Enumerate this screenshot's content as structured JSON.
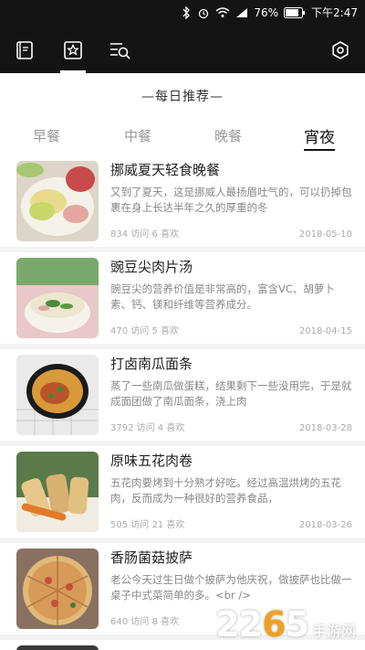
{
  "status_bar": {
    "battery": "76%",
    "time": "下午2:47"
  },
  "navbar": {
    "icons": [
      "book-icon",
      "star-card-icon",
      "search-list-icon",
      "settings-icon"
    ]
  },
  "daily": {
    "title": "—每日推荐—"
  },
  "tabs": [
    {
      "label": "早餐"
    },
    {
      "label": "中餐"
    },
    {
      "label": "晚餐"
    },
    {
      "label": "宵夜",
      "active": true
    }
  ],
  "items": [
    {
      "title": "挪威夏天轻食晚餐",
      "desc": "又到了夏天，这是挪威人最扬眉吐气的，可以扔掉包裹在身上长达半年之久的厚重的冬",
      "meta": "834 访问 6 喜欢",
      "date": "2018-05-10"
    },
    {
      "title": "豌豆尖肉片汤",
      "desc": "豌豆尖的营养价值是非常高的，富含VC、胡萝卜素、钙、镁和纤维等营养成分。",
      "meta": "470 访问 5 喜欢",
      "date": "2018-04-15"
    },
    {
      "title": "打卤南瓜面条",
      "desc": "蒸了一些南瓜做蛋糕，结果剩下一些没用完，于是就成面团做了南瓜面条，浇上肉",
      "meta": "3792 访问 4 喜欢",
      "date": "2018-03-28"
    },
    {
      "title": "原味五花肉卷",
      "desc": "五花肉要烤到十分熟才好吃。经过高温烘烤的五花肉，反而成为一种很好的营养食品，",
      "meta": "505 访问 21 喜欢",
      "date": "2018-03-26"
    },
    {
      "title": "香肠菌菇披萨",
      "desc": "老公今天过生日做个披萨为他庆祝，做披萨也比做一桌子中式菜简单的多。<br />",
      "meta": "640 访问 8 喜欢",
      "date": ""
    }
  ],
  "watermark": {
    "number_pre": "22",
    "number_hl": "6",
    "number_post": "5",
    "text": "手游网"
  },
  "colors": {
    "bar": "#141414",
    "background": "#f2f2f2",
    "accent": "#f0a020"
  }
}
